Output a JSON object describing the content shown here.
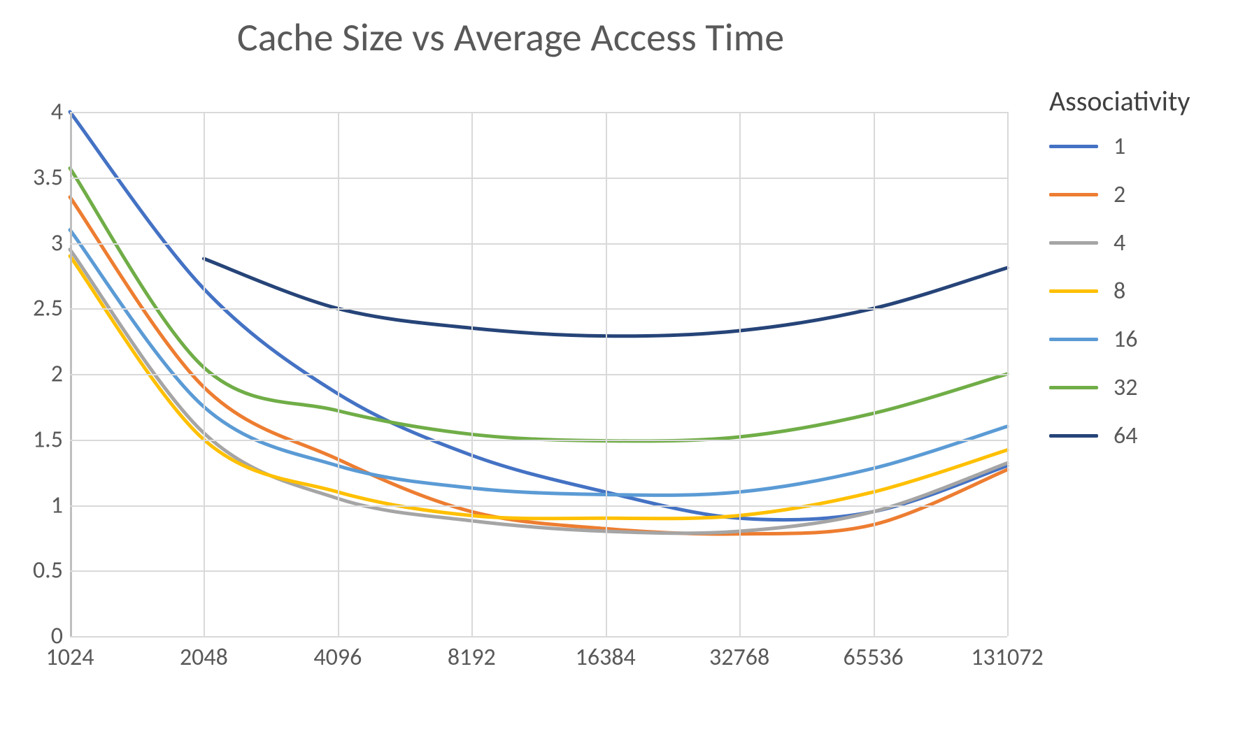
{
  "chart_data": {
    "type": "line",
    "title": "Cache Size vs Average Access Time",
    "xlabel": "",
    "ylabel": "",
    "x_scale": "log2",
    "ylim": [
      0,
      4
    ],
    "xlim": [
      1024,
      131072
    ],
    "x_ticks": [
      1024,
      2048,
      4096,
      8192,
      16384,
      32768,
      65536,
      131072
    ],
    "y_ticks": [
      0,
      0.5,
      1,
      1.5,
      2,
      2.5,
      3,
      3.5,
      4
    ],
    "categories": [
      1024,
      2048,
      4096,
      8192,
      16384,
      32768,
      65536,
      131072
    ],
    "legend_title": "Associativity",
    "series": [
      {
        "name": "1",
        "color": "#4472C4",
        "values": [
          4.0,
          2.65,
          1.85,
          1.38,
          1.1,
          0.9,
          0.95,
          1.3
        ]
      },
      {
        "name": "2",
        "color": "#ED7D31",
        "values": [
          3.35,
          1.9,
          1.35,
          0.95,
          0.82,
          0.78,
          0.85,
          1.27
        ]
      },
      {
        "name": "4",
        "color": "#A5A5A5",
        "values": [
          2.95,
          1.55,
          1.05,
          0.88,
          0.8,
          0.8,
          0.95,
          1.32
        ]
      },
      {
        "name": "8",
        "color": "#FFC000",
        "values": [
          2.9,
          1.5,
          1.1,
          0.92,
          0.9,
          0.92,
          1.1,
          1.42
        ]
      },
      {
        "name": "16",
        "color": "#5B9BD5",
        "values": [
          3.1,
          1.75,
          1.3,
          1.13,
          1.08,
          1.1,
          1.28,
          1.6
        ]
      },
      {
        "name": "32",
        "color": "#70AD47",
        "values": [
          3.57,
          2.05,
          1.72,
          1.54,
          1.49,
          1.52,
          1.7,
          2.0
        ]
      },
      {
        "name": "64",
        "color": "#264478",
        "values": [
          null,
          2.88,
          2.5,
          2.35,
          2.29,
          2.33,
          2.5,
          2.81
        ]
      }
    ]
  }
}
